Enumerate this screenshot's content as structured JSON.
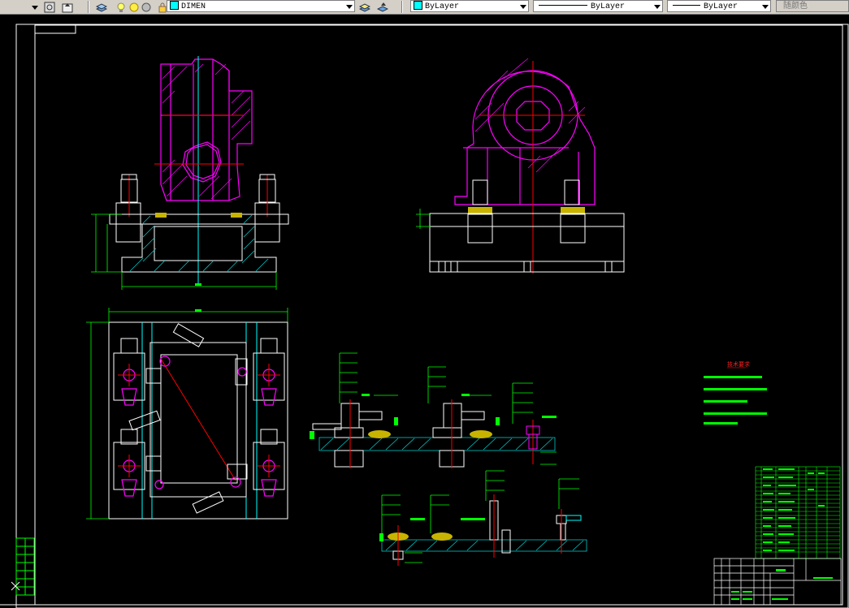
{
  "toolbar": {
    "layer_name": "DIMEN",
    "layer_color": "#00ffff",
    "color_control": "ByLayer",
    "color_swatch": "#00ffff",
    "linetype_control": "ByLayer",
    "lineweight_control": "ByLayer",
    "plotstyle_control": "随颜色"
  },
  "drawing": {
    "technical_requirements_title": "技术要求",
    "colors": {
      "frame": "#ffffff",
      "part": "#ff00ff",
      "fixture": "#ffffff",
      "center": "#ff0000",
      "axis": "#00ffff",
      "dimension": "#00ff00",
      "hatch": "#00c8c8",
      "weld": "#c8b400"
    }
  }
}
